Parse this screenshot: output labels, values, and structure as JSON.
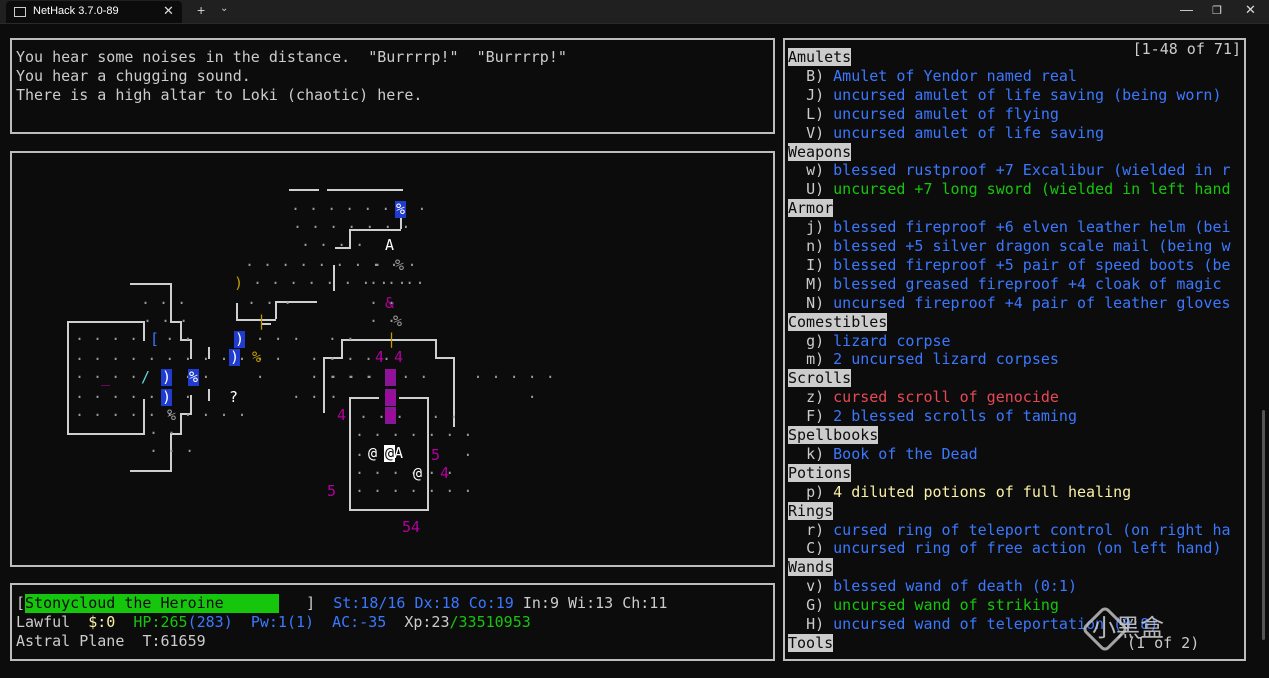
{
  "window": {
    "tab_title": "NetHack 3.7.0-89",
    "tab_close": "✕",
    "new_tab": "+",
    "tab_dropdown": "⌄",
    "minimize": "—",
    "maximize": "❐",
    "close": "✕"
  },
  "messages": [
    "You hear some noises in the distance.  \"Burrrrp!\"  \"Burrrrp!\"",
    "You hear a chugging sound.",
    "There is a high altar to Loki (chaotic) here."
  ],
  "status": {
    "name": "Stonycloud the Heroine",
    "st": "St:18/16",
    "dx": "Dx:18",
    "co": "Co:19",
    "in": "In:9",
    "wi": "Wi:13",
    "ch": "Ch:11",
    "alignment": "Lawful",
    "gold": "$:0",
    "hp_label": "HP:265",
    "hp_max": "(283)",
    "pw_label": "Pw:1",
    "pw_max": "(1)",
    "ac": "AC:-35",
    "xp_label": "Xp:23",
    "xp_points": "/33510953",
    "dungeon_level": "Astral Plane",
    "turn": "T:61659"
  },
  "inventory": {
    "range": "[1-48 of 71]",
    "more": "(1 of 2)",
    "categories": [
      {
        "name": "Amulets",
        "items": [
          {
            "letter": "B)",
            "text": "Amulet of Yendor named real",
            "color": "#3b78ff"
          },
          {
            "letter": "J)",
            "text": "uncursed amulet of life saving (being worn)",
            "color": "#3b78ff"
          },
          {
            "letter": "L)",
            "text": "uncursed amulet of flying",
            "color": "#3b78ff"
          },
          {
            "letter": "V)",
            "text": "uncursed amulet of life saving",
            "color": "#3b78ff"
          }
        ]
      },
      {
        "name": "Weapons",
        "items": [
          {
            "letter": "w)",
            "text": "blessed rustproof +7 Excalibur (wielded in r",
            "color": "#3b78ff"
          },
          {
            "letter": "U)",
            "text": "uncursed +7 long sword (wielded in left hand",
            "color": "#16c60c"
          }
        ]
      },
      {
        "name": "Armor",
        "items": [
          {
            "letter": "j)",
            "text": "blessed fireproof +6 elven leather helm (bei",
            "color": "#3b78ff"
          },
          {
            "letter": "n)",
            "text": "blessed +5 silver dragon scale mail (being w",
            "color": "#3b78ff"
          },
          {
            "letter": "I)",
            "text": "blessed fireproof +5 pair of speed boots (be",
            "color": "#3b78ff"
          },
          {
            "letter": "M)",
            "text": "blessed greased fireproof +4 cloak of magic",
            "color": "#3b78ff"
          },
          {
            "letter": "N)",
            "text": "uncursed fireproof +4 pair of leather gloves",
            "color": "#3b78ff"
          }
        ]
      },
      {
        "name": "Comestibles",
        "items": [
          {
            "letter": "g)",
            "text": "lizard corpse",
            "color": "#3b78ff"
          },
          {
            "letter": "m)",
            "text": "2 uncursed lizard corpses",
            "color": "#3b78ff"
          }
        ]
      },
      {
        "name": "Scrolls",
        "items": [
          {
            "letter": "z)",
            "text": "cursed scroll of genocide",
            "color": "#e74856"
          },
          {
            "letter": "F)",
            "text": "2 blessed scrolls of taming",
            "color": "#3b78ff"
          }
        ]
      },
      {
        "name": "Spellbooks",
        "items": [
          {
            "letter": "k)",
            "text": "Book of the Dead",
            "color": "#3b78ff"
          }
        ]
      },
      {
        "name": "Potions",
        "items": [
          {
            "letter": "p)",
            "text": "4 diluted potions of full healing",
            "color": "#f9f1a5"
          }
        ]
      },
      {
        "name": "Rings",
        "items": [
          {
            "letter": "r)",
            "text": "cursed ring of teleport control (on right ha",
            "color": "#3b78ff"
          },
          {
            "letter": "C)",
            "text": "uncursed ring of free action (on left hand)",
            "color": "#3b78ff"
          }
        ]
      },
      {
        "name": "Wands",
        "items": [
          {
            "letter": "v)",
            "text": "blessed wand of death (0:1)",
            "color": "#3b78ff"
          },
          {
            "letter": "G)",
            "text": "uncursed wand of striking",
            "color": "#16c60c"
          },
          {
            "letter": "H)",
            "text": "uncursed wand of teleportation (0:8)",
            "color": "#3b78ff"
          }
        ]
      },
      {
        "name": "Tools",
        "items": []
      }
    ]
  },
  "map": {
    "glyphs": [
      {
        "ch": "%",
        "color": "#ffffff",
        "bg": "#1f3bd0",
        "name": "item-percent"
      },
      {
        "ch": "A",
        "color": "#ffffff",
        "name": "monster-angel"
      },
      {
        "ch": "%",
        "color": "#9a9a9a",
        "name": "item-percent"
      },
      {
        "ch": ")",
        "color": "#c19c00",
        "name": "item-weapon"
      },
      {
        "ch": "&",
        "color": "#b4009e",
        "name": "monster-demon"
      },
      {
        "ch": "%",
        "color": "#9a9a9a",
        "name": "item-percent"
      },
      {
        "ch": "|",
        "color": "#c19c00",
        "name": "door-open"
      },
      {
        "ch": "%",
        "color": "#c19c00",
        "name": "item-percent"
      },
      {
        "ch": "|",
        "color": "#c19c00",
        "name": "door-open"
      },
      {
        "ch": "[",
        "color": "#3b78ff",
        "bg": "#0c0c0c",
        "name": "item-armor"
      },
      {
        "ch": ")",
        "color": "#ffffff",
        "bg": "#1f3bd0",
        "name": "item-weapon"
      },
      {
        "ch": ")",
        "color": "#ffffff",
        "bg": "#1f3bd0",
        "name": "item-weapon"
      },
      {
        "ch": ")",
        "color": "#ffffff",
        "bg": "#1f3bd0",
        "name": "item-weapon"
      },
      {
        "ch": ")",
        "color": "#ffffff",
        "bg": "#1f3bd0",
        "name": "item-weapon"
      },
      {
        "ch": "%",
        "color": "#ffffff",
        "bg": "#1f3bd0",
        "name": "item-percent"
      },
      {
        "ch": "/",
        "color": "#61d6d6",
        "name": "item-wand"
      },
      {
        "ch": "_",
        "color": "#b4009e",
        "name": "altar"
      },
      {
        "ch": "?",
        "color": "#ffffff",
        "name": "item-scroll"
      },
      {
        "ch": "%",
        "color": "#9a9a9a",
        "name": "item-percent"
      },
      {
        "ch": "4",
        "color": "#b4009e",
        "name": "monster-4"
      },
      {
        "ch": "4",
        "color": "#b4009e",
        "name": "monster-4"
      },
      {
        "ch": "4",
        "color": "#b4009e",
        "name": "monster-4"
      },
      {
        "ch": "T",
        "color": "#b4009e",
        "bg": "#881798",
        "name": "monster-troll"
      },
      {
        "ch": "W",
        "color": "#b4009e",
        "bg": "#881798",
        "name": "monster-wraith"
      },
      {
        "ch": "W",
        "color": "#b4009e",
        "bg": "#881798",
        "name": "monster-wraith"
      },
      {
        "ch": "@",
        "color": "#0c0c0c",
        "bg": "#ffffff",
        "name": "player"
      },
      {
        "ch": "@",
        "color": "#ffffff",
        "name": "monster-human"
      },
      {
        "ch": "A",
        "color": "#ffffff",
        "name": "monster-angel"
      },
      {
        "ch": "@",
        "color": "#ffffff",
        "name": "monster-human"
      },
      {
        "ch": "5",
        "color": "#b4009e",
        "name": "monster-5"
      },
      {
        "ch": "4",
        "color": "#b4009e",
        "name": "monster-4"
      },
      {
        "ch": "5",
        "color": "#b4009e",
        "name": "monster-5"
      },
      {
        "ch": "54",
        "color": "#b4009e",
        "name": "monster-54"
      }
    ]
  },
  "watermark": {
    "text": "小黑盒"
  }
}
